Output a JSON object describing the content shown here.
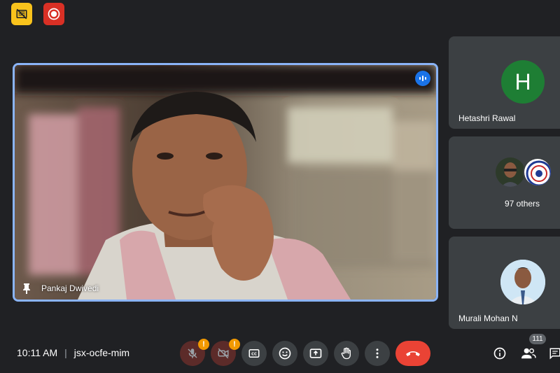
{
  "top_controls": {
    "no_view_icon": "hide-tile-icon",
    "record_icon": "recording-icon"
  },
  "main_tile": {
    "participant_name": "Pankaj Dwivedi",
    "pin_icon": "pin-icon",
    "speaking_icon": "audio-level-icon"
  },
  "side_tiles": [
    {
      "name": "Hetashri Rawal",
      "avatar_letter": "H",
      "avatar_color": "#1e7e34"
    },
    {
      "others_label": "97 others"
    },
    {
      "name": "Murali Mohan N"
    }
  ],
  "meeting": {
    "time": "10:11 AM",
    "code": "jsx-ocfe-mim"
  },
  "controls": {
    "mic_badge": "!",
    "camera_badge": "!",
    "participant_count": "111"
  },
  "colors": {
    "background": "#202124",
    "active_border": "#8ab4f8",
    "end_call": "#ea4335",
    "warning": "#f29900"
  }
}
